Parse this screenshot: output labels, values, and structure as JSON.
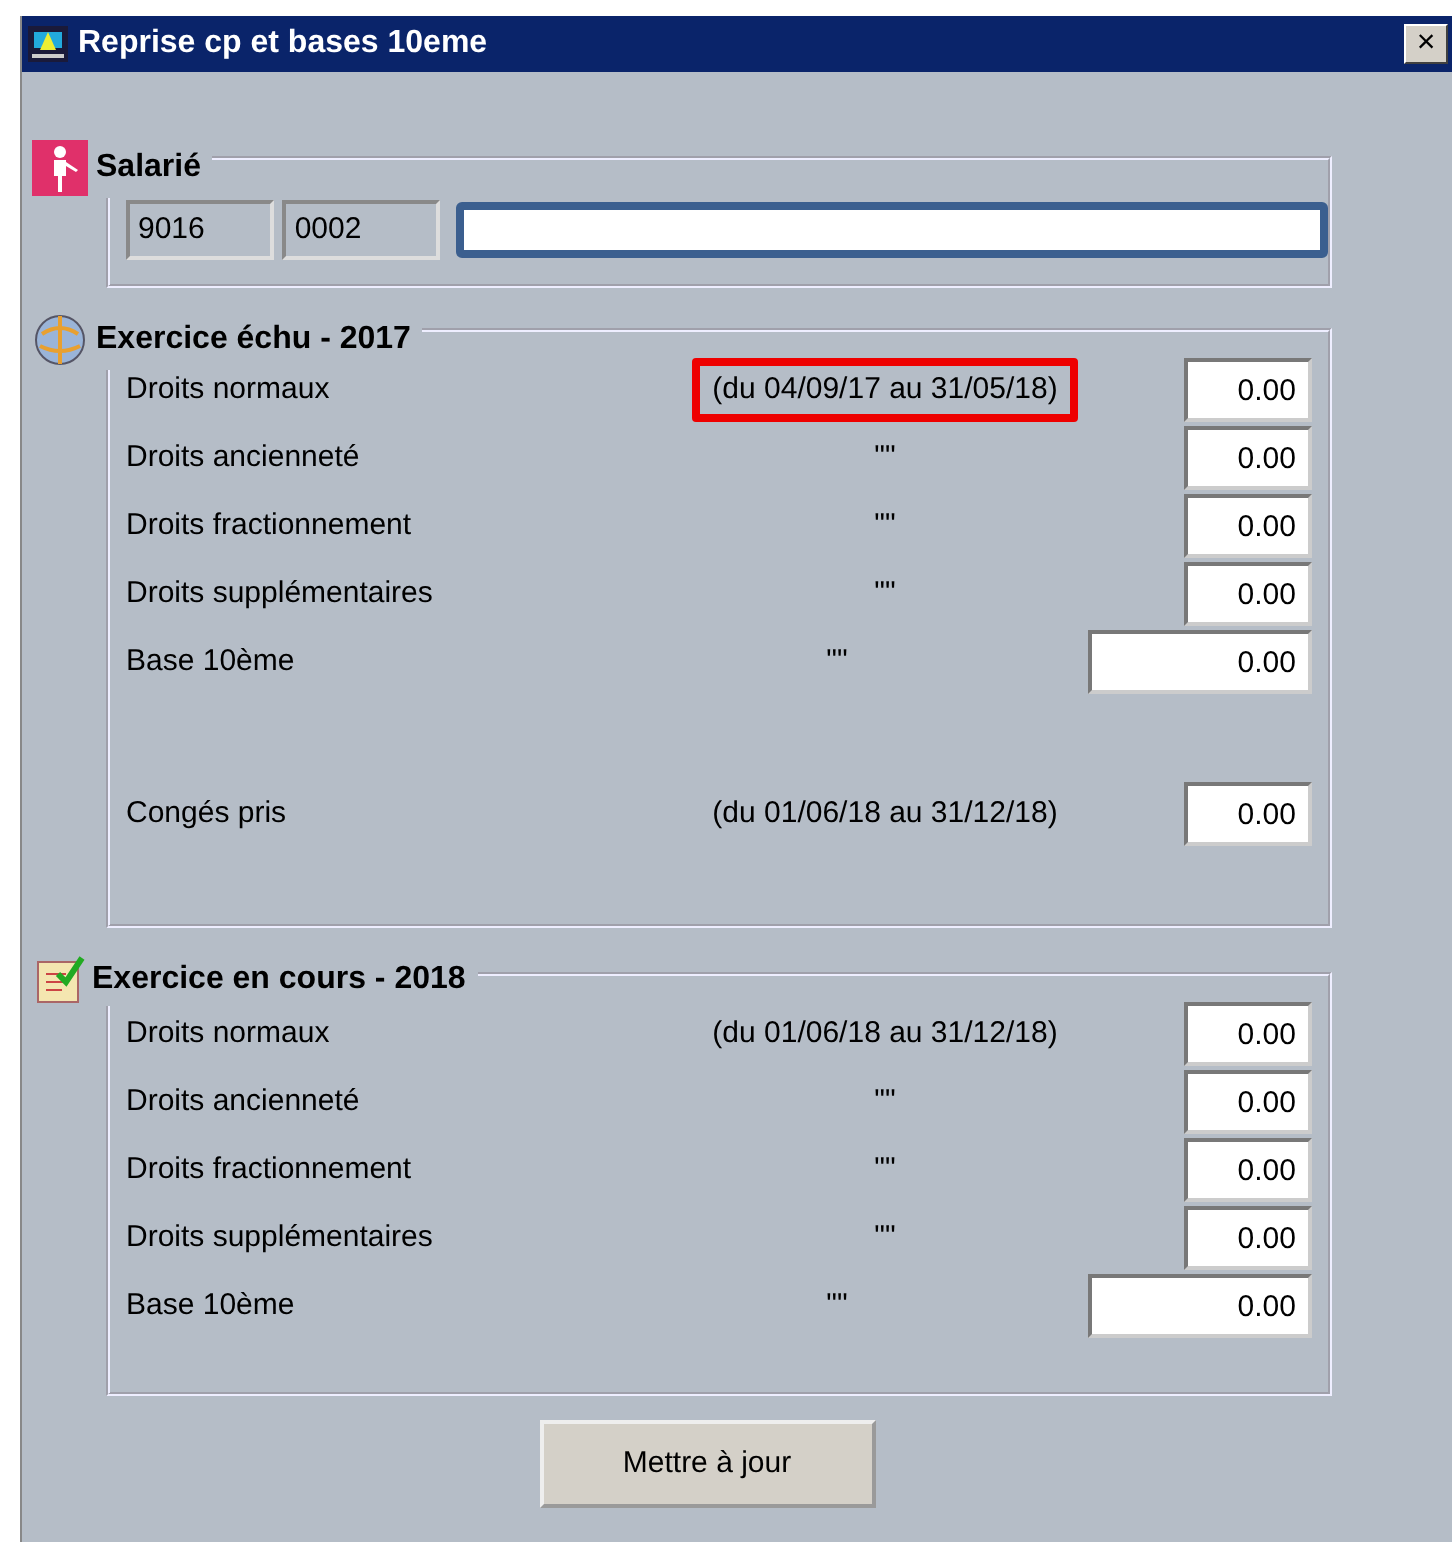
{
  "window": {
    "title": "Reprise cp et bases 10eme",
    "close": "×"
  },
  "salarie": {
    "title": "Salarié",
    "code_1": "9016",
    "code_2": "0002"
  },
  "sections": [
    {
      "title": "Exercice échu - 2017",
      "rows": [
        {
          "kind": "droit",
          "label": "Droits normaux",
          "period": "(du 04/09/17 au 31/05/18)",
          "highlighted": true,
          "value": "0.00"
        },
        {
          "kind": "droit",
          "label": "Droits ancienneté",
          "period": "\"\"",
          "highlighted": false,
          "value": "0.00"
        },
        {
          "kind": "droit",
          "label": "Droits fractionnement",
          "period": "\"\"",
          "highlighted": false,
          "value": "0.00"
        },
        {
          "kind": "droit",
          "label": "Droits supplémentaires",
          "period": "\"\"",
          "highlighted": false,
          "value": "0.00"
        },
        {
          "kind": "base",
          "label": "Base 10ème",
          "period": "\"\"",
          "highlighted": false,
          "value": "0.00"
        },
        {
          "kind": "pris",
          "label": "Congés pris",
          "period": "(du 01/06/18 au 31/12/18)",
          "highlighted": false,
          "value": "0.00"
        }
      ]
    },
    {
      "title": "Exercice en cours - 2018",
      "rows": [
        {
          "kind": "droit",
          "label": "Droits normaux",
          "period": "(du 01/06/18 au 31/12/18)",
          "highlighted": false,
          "value": "0.00"
        },
        {
          "kind": "droit",
          "label": "Droits ancienneté",
          "period": "\"\"",
          "highlighted": false,
          "value": "0.00"
        },
        {
          "kind": "droit",
          "label": "Droits fractionnement",
          "period": "\"\"",
          "highlighted": false,
          "value": "0.00"
        },
        {
          "kind": "droit",
          "label": "Droits supplémentaires",
          "period": "\"\"",
          "highlighted": false,
          "value": "0.00"
        },
        {
          "kind": "base",
          "label": "Base 10ème",
          "period": "\"\"",
          "highlighted": false,
          "value": "0.00"
        }
      ]
    }
  ],
  "button": "Mettre à jour"
}
